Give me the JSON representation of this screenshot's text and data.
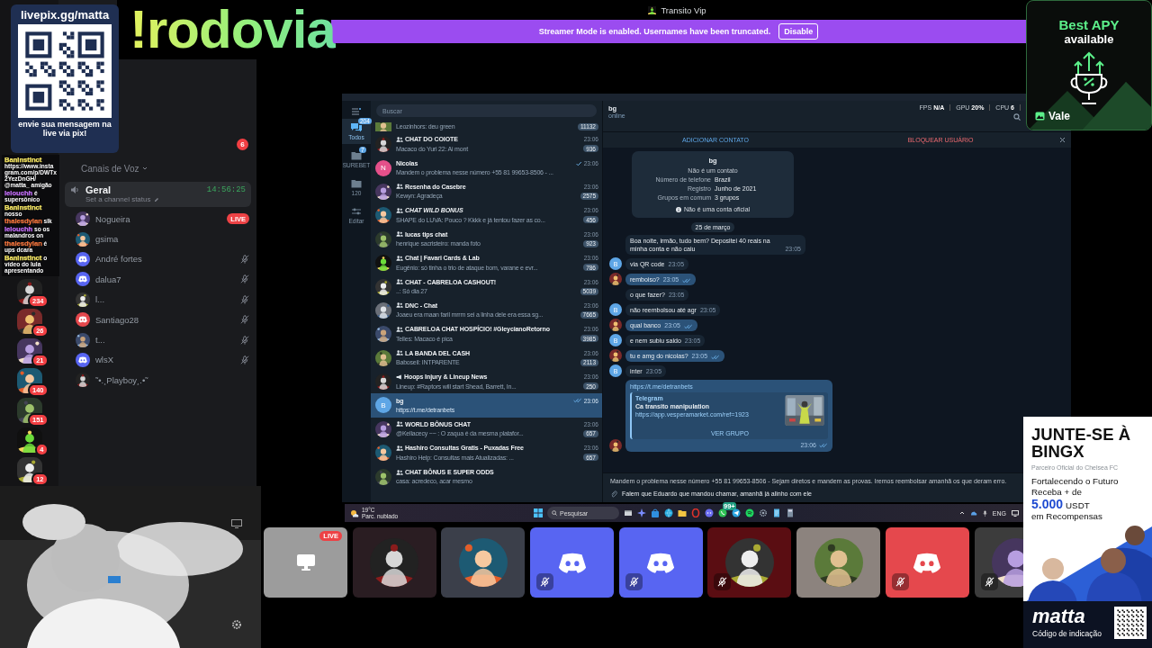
{
  "overlay": {
    "pix_link": "livepix.gg/matta",
    "pix_caption": "envie sua mensagem na live via pix!",
    "command": "!rodovia"
  },
  "server_rail": [
    {
      "badge": "234"
    },
    {
      "badge": "26"
    },
    {
      "badge": "21"
    },
    {
      "badge": "140"
    },
    {
      "badge": "151"
    },
    {
      "badge": "4"
    },
    {
      "badge": "12"
    }
  ],
  "stream_chat": [
    {
      "user": "BanInstinct",
      "color": "#f5e663",
      "text": "https://www.instagram.com/p/DWTx2YezDnGH/ @matta_ amigão"
    },
    {
      "user": "lelouchh",
      "color": "#c06cf5",
      "text": "é supersônico"
    },
    {
      "user": "BanInstinct",
      "color": "#f5e663",
      "text": "nosso"
    },
    {
      "user": "thalesdylan",
      "color": "#f0733c",
      "text": "slk"
    },
    {
      "user": "lelouchh",
      "color": "#c06cf5",
      "text": "so os malandros on"
    },
    {
      "user": "thalesdylan",
      "color": "#f0733c",
      "text": "é ups dcara"
    },
    {
      "user": "BanInstinct",
      "color": "#f5e663",
      "text": "o vídeo do lula apresentando"
    }
  ],
  "channels": {
    "badge": "6",
    "category": "Canais de Voz",
    "channel": {
      "name": "Geral",
      "timer": "14:56:25",
      "status_placeholder": "Set a channel status"
    },
    "members": [
      {
        "name": "Nogueira",
        "kind": "picture",
        "badge": "LIVE",
        "muted": false
      },
      {
        "name": "gsima",
        "kind": "picture",
        "muted": false
      },
      {
        "name": "André fortes",
        "kind": "logo",
        "color": "#5865f2",
        "muted": true
      },
      {
        "name": "dalua7",
        "kind": "logo",
        "color": "#5865f2",
        "muted": true
      },
      {
        "name": "l...",
        "kind": "picture",
        "muted": true
      },
      {
        "name": "Santiago28",
        "kind": "logo",
        "color": "#e5484d",
        "muted": true
      },
      {
        "name": "t...",
        "kind": "picture",
        "muted": true
      },
      {
        "name": "wlsX",
        "kind": "logo",
        "color": "#5865f2",
        "muted": true
      },
      {
        "name": "˜•.¸Playboy¸.•˜",
        "kind": "picture",
        "muted": false
      }
    ]
  },
  "stream": {
    "title": "Transito Vip",
    "banner": "Streamer Mode is enabled. Usernames have been truncated.",
    "banner_button": "Disable"
  },
  "telegram": {
    "folders": [
      {
        "label": "Todos",
        "kind": "chats",
        "badge": "204",
        "selected": true
      },
      {
        "label": "SUREBET",
        "kind": "folder",
        "badge": "7",
        "selected": false
      },
      {
        "label": "120",
        "kind": "folder",
        "selected": false
      },
      {
        "label": "Editar",
        "kind": "edit",
        "selected": false
      }
    ],
    "search_placeholder": "Buscar",
    "chats": [
      {
        "preview": "Leozinhors: deu green",
        "count": "11132",
        "selected": false
      },
      {
        "kind": "group",
        "name": "CHAT DO COIOTE",
        "time": "23:06",
        "preview": "Macaco do Yuri 22: Ai mont",
        "count": "936",
        "selected": false
      },
      {
        "kind": "user",
        "name": "Nicolas",
        "time": "23:06",
        "read": false,
        "letter": "N",
        "color": "#e5508a",
        "preview": "Mandem o problema nesse número +55 81 99653-8506 - ...",
        "selected": false
      },
      {
        "kind": "group",
        "name": "Resenha do Casebre",
        "time": "23:06",
        "preview": "Kewyn: Agradeça",
        "count": "2575",
        "selected": false
      },
      {
        "kind": "group",
        "name": "CHAT WILD BONUS",
        "time": "23:06",
        "preview": "SHAPE do LUVA: Pouco ? Kkkk e já tentou fazer as co...",
        "count": "456",
        "selected": false
      },
      {
        "kind": "group",
        "name": "lucas tips chat",
        "time": "23:06",
        "preview": "henrique sacristeiro: manda foto",
        "count": "923",
        "selected": false
      },
      {
        "kind": "group",
        "name": "Chat | Favari Cards & Lab",
        "time": "23:06",
        "preview": "Eugênio: só tinha o trio de ataque bom, varane e evr...",
        "count": "786",
        "selected": false
      },
      {
        "kind": "group",
        "name": "CHAT - CABRELOA CASHOUT!",
        "time": "23:06",
        "preview": "..: Só dia 27",
        "count": "5039",
        "selected": false
      },
      {
        "kind": "group",
        "name": "DNC - Chat",
        "time": "23:06",
        "preview": "Joaeu era maan faril mrrm sei a linha dele era essa sg...",
        "count": "7665",
        "selected": false
      },
      {
        "kind": "group",
        "name": "CABRELOA CHAT HOSPÍCIO! #GleycianoRetorno",
        "time": "23:06",
        "preview": "Telles: Macaco é pica",
        "count": "3985",
        "selected": false
      },
      {
        "kind": "group",
        "name": "LA BANDA DEL CASH",
        "time": "23:06",
        "preview": "Baboseil: INTPARENTE",
        "count": "2113",
        "selected": false
      },
      {
        "kind": "channel",
        "name": "Hoops Injury & Lineup News",
        "time": "23:06",
        "preview": "Lineup: #Raptors will start Shead, Barrett, In...",
        "count": "250",
        "selected": false
      },
      {
        "kind": "user",
        "name": "bg",
        "time": "23:06",
        "read": true,
        "letter": "B",
        "color": "#5ea6e6",
        "preview": "https://t.me/detranbets",
        "selected": true
      },
      {
        "kind": "group",
        "name": "WORLD BÔNUS CHAT",
        "time": "23:06",
        "preview": "@Kellacecy ~~ : O zaqua é da mesma platafor...",
        "count": "657",
        "selected": false
      },
      {
        "kind": "group",
        "name": "Hashiro Consultas Gratis - Puxadas Free",
        "time": "23:06",
        "preview": "Hashiro Help: Consultas mais Atualizadas: ...",
        "count": "657",
        "selected": false
      },
      {
        "kind": "group",
        "name": "CHAT BÔNUS E SUPER ODDS",
        "preview": "casa: acredeco, acar mesmo",
        "selected": false
      }
    ],
    "contact": {
      "name": "bg",
      "presence": "online",
      "add": "ADICIONAR CONTATO",
      "block": "BLOQUEAR USUÁRIO"
    },
    "stats": [
      {
        "label": "FPS",
        "value": "N/A"
      },
      {
        "label": "GPU",
        "value": "20%"
      },
      {
        "label": "CPU",
        "value": "6"
      }
    ],
    "info_card": {
      "name": "bg",
      "subtitle": "Não é um contato",
      "rows": [
        {
          "label": "Número de telefone",
          "value": "Brazil"
        },
        {
          "label": "Registro",
          "value": "Junho de 2021"
        },
        {
          "label": "Grupos em comum",
          "value": "3 grupos"
        }
      ],
      "note": "Não é uma conta oficial"
    },
    "date": "25 de março",
    "messages": [
      {
        "kind": "text",
        "outgoing": false,
        "text": "Boa noite, irmão, tudo bem? Depositei 40 reais na minha conta e não caiu",
        "time": "23:05",
        "avatar": false
      },
      {
        "kind": "text",
        "outgoing": false,
        "text": "via QR code",
        "time": "23:05",
        "avatar": true,
        "letter": "B"
      },
      {
        "kind": "text",
        "outgoing": true,
        "text": "remboiso?",
        "time": "23:05",
        "read": true,
        "avatar": true
      },
      {
        "kind": "text",
        "outgoing": false,
        "text": "o que fazer?",
        "time": "23:05",
        "avatar": false
      },
      {
        "kind": "text",
        "outgoing": false,
        "text": "não reembolsou até agr",
        "time": "23:05",
        "avatar": true,
        "letter": "B"
      },
      {
        "kind": "text",
        "outgoing": true,
        "text": "qual banco",
        "time": "23:05",
        "read": true,
        "avatar": true
      },
      {
        "kind": "text",
        "outgoing": false,
        "text": "e nem subiu saldo",
        "time": "23:05",
        "avatar": true,
        "letter": "B"
      },
      {
        "kind": "text",
        "outgoing": true,
        "text": "tu e amg do nicolas?",
        "time": "23:05",
        "read": true,
        "avatar": true
      },
      {
        "kind": "text",
        "outgoing": false,
        "text": "inter",
        "time": "23:05",
        "avatar": true,
        "letter": "B"
      },
      {
        "kind": "link",
        "outgoing": true,
        "url": "https://t.me/detranbets",
        "site": "Telegram",
        "title": "Ca transito manipulation",
        "link": "https://app.vesperamarket.com/ref=1923",
        "button": "VER GRUPO",
        "time": "23:06",
        "read": true,
        "avatar": true
      }
    ],
    "pinned": "Mandem o problema nesse número +55 81 99653-8506 - Sejam diretos e mandem as provas. Iremos reembolsar amanhã os que deram erro.",
    "input": "Falem que Eduardo que mandou chamar, amanhã já alinho com ele"
  },
  "taskbar": {
    "temperature": "19°C",
    "weather": "Parc. nublado",
    "search_placeholder": "Pesquisar",
    "badge": "99+",
    "language": "ENG"
  },
  "tiles": [
    {
      "kind": "screen",
      "badge": "LIVE",
      "muted": false
    },
    {
      "kind": "picture",
      "muted": false
    },
    {
      "kind": "picture",
      "muted": false
    },
    {
      "kind": "logo",
      "color": "#5865f2",
      "muted": true
    },
    {
      "kind": "logo",
      "color": "#5865f2",
      "muted": true
    },
    {
      "kind": "picture",
      "muted": true
    },
    {
      "kind": "picture",
      "muted": false
    },
    {
      "kind": "logo",
      "color": "#e5484d",
      "muted": true
    },
    {
      "kind": "picture",
      "muted": true
    }
  ],
  "ad_top": {
    "headline": "Best APY",
    "subline": "available",
    "brand": "Vale"
  },
  "ad_side": {
    "headline": "JUNTE-SE À BINGX",
    "partner": "Parceiro Oficial do Chelsea FC",
    "line_1": "Fortalecendo o Futuro",
    "line_2": "Receba + de",
    "amount": "5.000",
    "unit": "USDT",
    "line_3": "em Recompensas",
    "code": "matta",
    "code_label": "Código de indicação"
  }
}
